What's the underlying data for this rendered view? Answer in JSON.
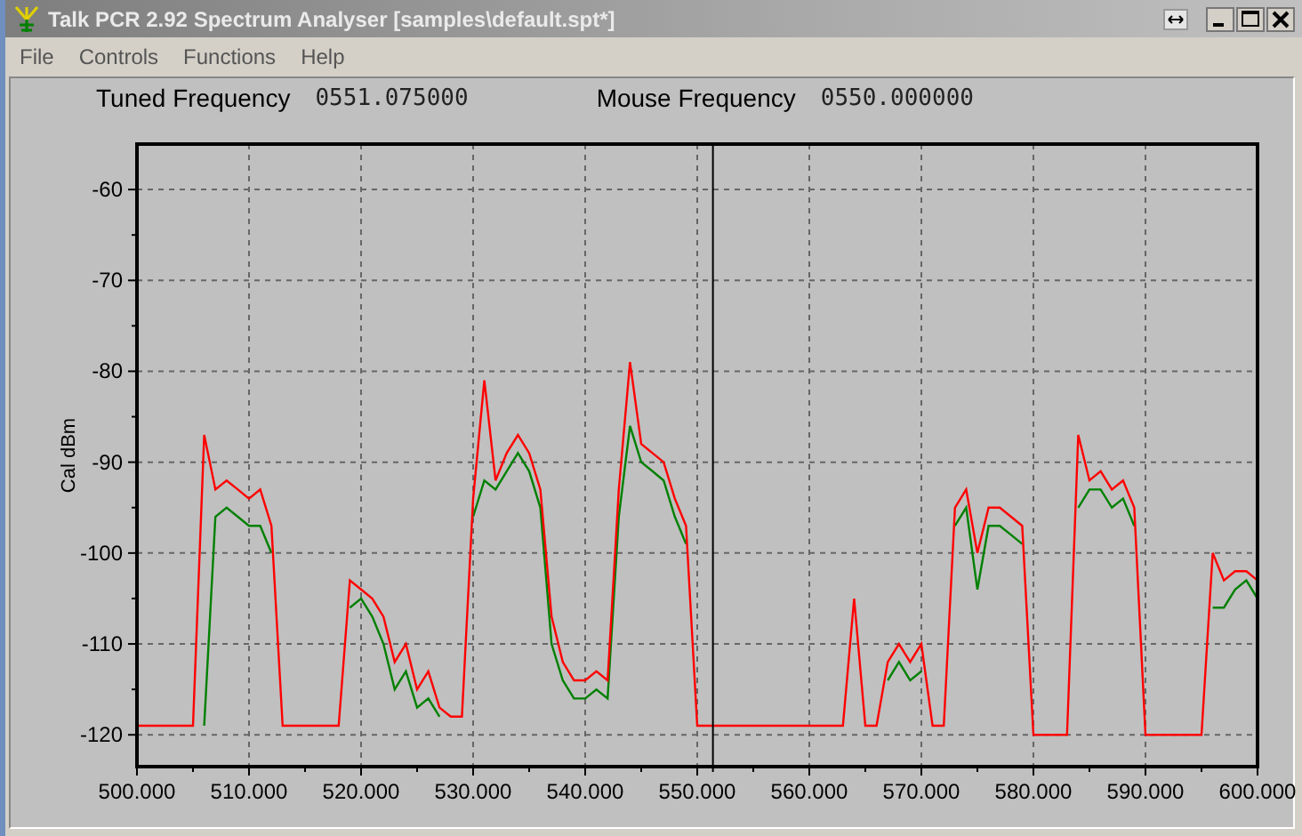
{
  "window": {
    "title": "Talk PCR 2.92 Spectrum Analyser [samples\\default.spt*]"
  },
  "menu": [
    {
      "label": "File"
    },
    {
      "label": "Controls"
    },
    {
      "label": "Functions"
    },
    {
      "label": "Help"
    }
  ],
  "readouts": [
    {
      "label": "Tuned Frequency",
      "value": "0551.075000"
    },
    {
      "label": "Mouse Frequency",
      "value": "0550.000000"
    }
  ],
  "chart_data": {
    "type": "line",
    "ylabel": "Cal dBm",
    "xlim": [
      500,
      600
    ],
    "ylim": [
      -123.5,
      -55
    ],
    "xticks": [
      {
        "value": 500,
        "label": "500.000"
      },
      {
        "value": 510,
        "label": "510.000"
      },
      {
        "value": 520,
        "label": "520.000"
      },
      {
        "value": 530,
        "label": "530.000"
      },
      {
        "value": 540,
        "label": "540.000"
      },
      {
        "value": 550,
        "label": "550.000"
      },
      {
        "value": 560,
        "label": "560.000"
      },
      {
        "value": 570,
        "label": "570.000"
      },
      {
        "value": 580,
        "label": "580.000"
      },
      {
        "value": 590,
        "label": "590.000"
      },
      {
        "value": 600,
        "label": "600.000"
      }
    ],
    "yticks": [
      -60,
      -70,
      -80,
      -90,
      -100,
      -110,
      -120
    ],
    "x": [
      500,
      501,
      502,
      503,
      504,
      505,
      506,
      507,
      508,
      509,
      510,
      511,
      512,
      513,
      514,
      515,
      516,
      517,
      518,
      519,
      520,
      521,
      522,
      523,
      524,
      525,
      526,
      527,
      528,
      529,
      530,
      531,
      532,
      533,
      534,
      535,
      536,
      537,
      538,
      539,
      540,
      541,
      542,
      543,
      544,
      545,
      546,
      547,
      548,
      549,
      550,
      551,
      552,
      553,
      554,
      555,
      556,
      557,
      558,
      559,
      560,
      561,
      562,
      563,
      564,
      565,
      566,
      567,
      568,
      569,
      570,
      571,
      572,
      573,
      574,
      575,
      576,
      577,
      578,
      579,
      580,
      581,
      582,
      583,
      584,
      585,
      586,
      587,
      588,
      589,
      590,
      591,
      592,
      593,
      594,
      595,
      596,
      597,
      598,
      599,
      600
    ],
    "series": [
      {
        "color": "#008000",
        "values": [
          null,
          null,
          null,
          null,
          null,
          null,
          -119,
          -96,
          -95,
          -96,
          -97,
          -97,
          -100,
          null,
          null,
          null,
          null,
          null,
          null,
          -106,
          -105,
          -107,
          -110,
          -115,
          -113,
          -117,
          -116,
          -118,
          null,
          null,
          -96,
          -92,
          -93,
          -91,
          -89,
          -91,
          -95,
          -110,
          -114,
          -116,
          -116,
          -115,
          -116,
          -96,
          -86,
          -90,
          -91,
          -92,
          -96,
          -99,
          null,
          null,
          null,
          null,
          null,
          null,
          null,
          null,
          null,
          null,
          null,
          null,
          null,
          null,
          null,
          null,
          null,
          -114,
          -112,
          -114,
          -113,
          null,
          null,
          -97,
          -95,
          -104,
          -97,
          -97,
          -98,
          -99,
          null,
          null,
          null,
          null,
          -95,
          -93,
          -93,
          -95,
          -94,
          -97,
          null,
          null,
          null,
          null,
          null,
          null,
          -106,
          -106,
          -104,
          -103,
          -105
        ]
      },
      {
        "color": "#ff0000",
        "values": [
          -119,
          -119,
          -119,
          -119,
          -119,
          -119,
          -87,
          -93,
          -92,
          -93,
          -94,
          -93,
          -97,
          -119,
          -119,
          -119,
          -119,
          -119,
          -119,
          -103,
          -104,
          -105,
          -107,
          -112,
          -110,
          -115,
          -113,
          -117,
          -118,
          -118,
          -94,
          -81,
          -92,
          -89,
          -87,
          -89,
          -93,
          -107,
          -112,
          -114,
          -114,
          -113,
          -114,
          -93,
          -79,
          -88,
          -89,
          -90,
          -94,
          -97,
          -119,
          -119,
          -119,
          -119,
          -119,
          -119,
          -119,
          -119,
          -119,
          -119,
          -119,
          -119,
          -119,
          -119,
          -105,
          -119,
          -119,
          -112,
          -110,
          -112,
          -110,
          -119,
          -119,
          -95,
          -93,
          -100,
          -95,
          -95,
          -96,
          -97,
          -120,
          -120,
          -120,
          -120,
          -87,
          -92,
          -91,
          -93,
          -92,
          -95,
          -120,
          -120,
          -120,
          -120,
          -120,
          -120,
          -100,
          -103,
          -102,
          -102,
          -103
        ]
      }
    ],
    "grid": true,
    "ref_lines": [
      {
        "axis": "x",
        "value": 551.4
      }
    ]
  }
}
